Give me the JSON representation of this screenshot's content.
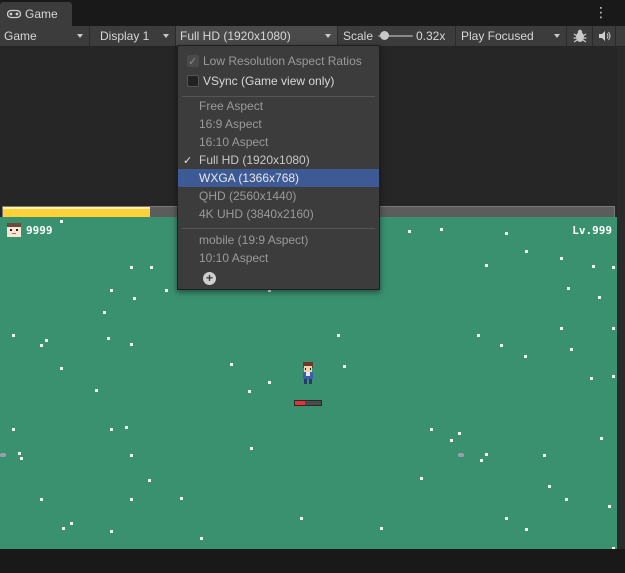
{
  "tab": {
    "label": "Game",
    "icon": "gamepad-icon"
  },
  "toolbar": {
    "view_select": "Game",
    "display_select": "Display 1",
    "resolution_select": "Full HD (1920x1080)",
    "scale_label": "Scale",
    "scale_value": "0.32x",
    "play_mode": "Play Focused"
  },
  "dropdown": {
    "low_res": "Low Resolution Aspect Ratios",
    "vsync": "VSync (Game view only)",
    "aspects": [
      {
        "label": "Free Aspect"
      },
      {
        "label": "16:9 Aspect"
      },
      {
        "label": "16:10 Aspect"
      },
      {
        "label": "Full HD (1920x1080)"
      },
      {
        "label": "WXGA (1366x768)"
      },
      {
        "label": "QHD (2560x1440)"
      },
      {
        "label": "4K UHD (3840x2160)"
      }
    ],
    "custom": [
      {
        "label": "mobile (19:9 Aspect)"
      },
      {
        "label": "10:10 Aspect"
      }
    ],
    "checked_item": "Full HD (1920x1080)",
    "highlighted_item": "WXGA (1366x768)"
  },
  "game": {
    "hp_fill_fraction": 0.24,
    "gold_count": "9999",
    "level": "Lv.999"
  },
  "colors": {
    "field": "#3a9170",
    "hp": "#ffd138",
    "highlight": "#3e5a95"
  }
}
